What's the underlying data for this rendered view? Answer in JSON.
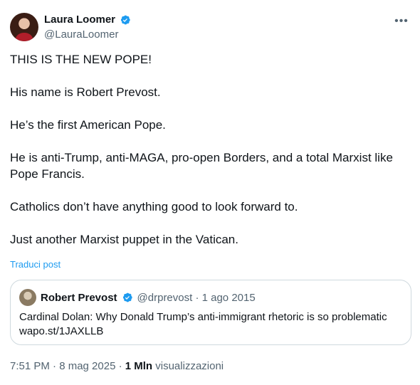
{
  "author": {
    "name": "Laura Loomer",
    "handle": "@LauraLoomer"
  },
  "post": {
    "text": "THIS IS THE NEW POPE!\n\nHis name is Robert Prevost.\n\nHe’s the first American Pope.\n\nHe is anti-Trump, anti-MAGA, pro-open Borders, and a total Marxist like Pope Francis.\n\nCatholics don’t have anything good to look forward to.\n\nJust another Marxist puppet in the Vatican.",
    "translate_label": "Traduci post"
  },
  "quoted": {
    "name": "Robert Prevost",
    "handle_date": "@drprevost · 1 ago 2015",
    "text": "Cardinal Dolan: Why Donald Trump’s anti-immigrant rhetoric is so problematic\nwapo.st/1JAXLLB"
  },
  "footer": {
    "time_date": "7:51 PM · 8 mag 2025 · ",
    "views_count": "1 Mln",
    "views_label": " visualizzazioni"
  },
  "icons": {
    "verified": "verified-badge-icon",
    "more": "more-options-icon"
  },
  "colors": {
    "verified": "#1d9bf0",
    "link": "#1d9bf0",
    "muted": "#536471"
  }
}
